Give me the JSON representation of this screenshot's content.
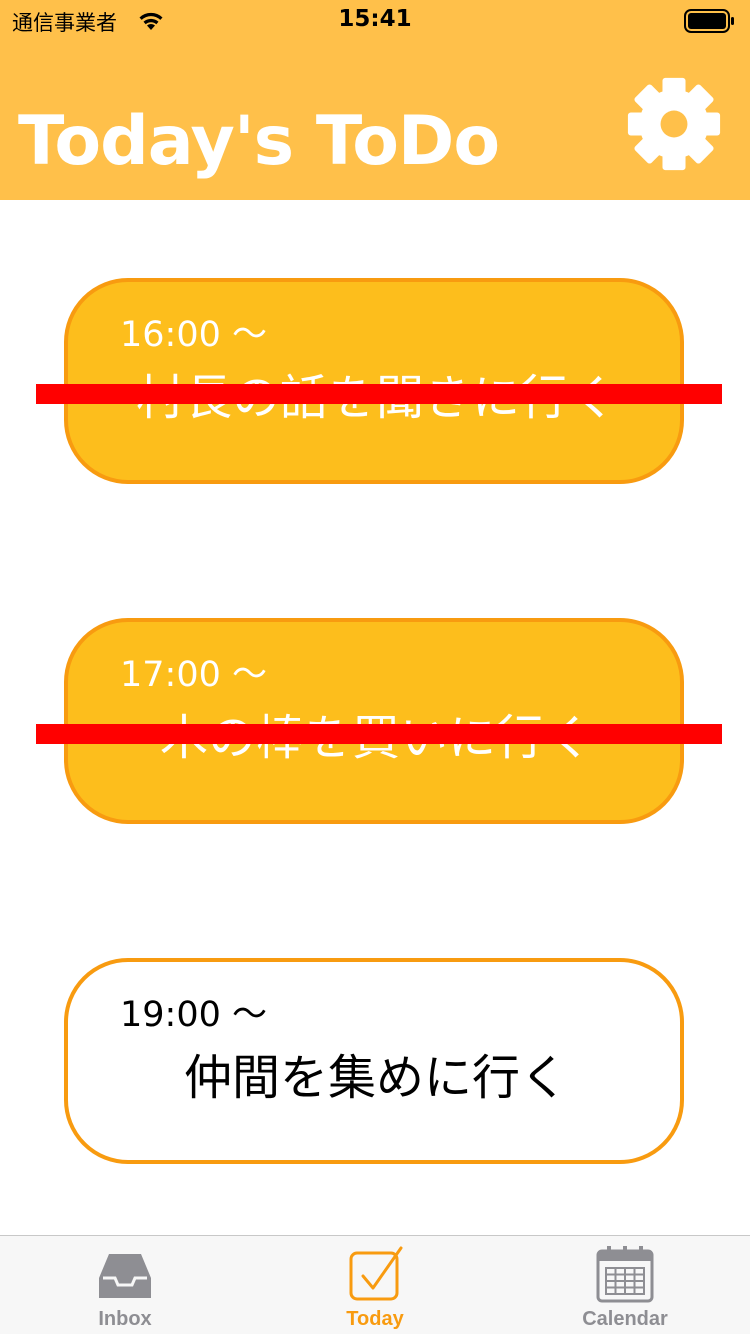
{
  "status_bar": {
    "carrier": "通信事業者",
    "time": "15:41"
  },
  "header": {
    "title": "Today's ToDo",
    "settings_icon": "gear-icon"
  },
  "tasks": [
    {
      "time": "16:00 ～",
      "title": "村長の話を聞きに行く",
      "done": true
    },
    {
      "time": "17:00 ～",
      "title": "木の棒を買いに行く",
      "done": true
    },
    {
      "time": "19:00 ～",
      "title": "仲間を集めに行く",
      "done": false
    }
  ],
  "tab_bar": {
    "items": [
      {
        "label": "Inbox",
        "icon": "inbox-icon",
        "selected": false
      },
      {
        "label": "Today",
        "icon": "checkbox-icon",
        "selected": true
      },
      {
        "label": "Calendar",
        "icon": "calendar-icon",
        "selected": false
      }
    ]
  },
  "colors": {
    "header": "#ffc04a",
    "done_card": "#fdbe1c",
    "card_border": "#f89b10",
    "strike": "#ff0000",
    "tab_selected": "#f89b10",
    "tab_unselected": "#8e8e93"
  }
}
